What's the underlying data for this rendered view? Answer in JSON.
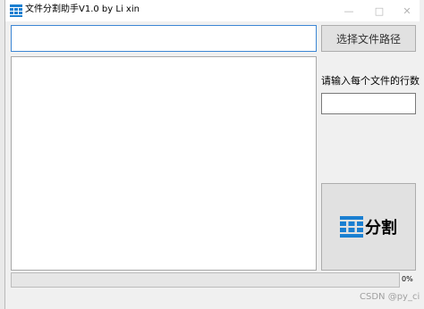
{
  "window": {
    "title": "文件分割助手V1.0 by Li xin",
    "icons": {
      "app": "grid-logo-icon",
      "minimize": "minimize-icon",
      "maximize": "maximize-icon",
      "close": "close-icon"
    },
    "controls": {
      "minimize": "—",
      "maximize": "□",
      "close": "✕"
    }
  },
  "form": {
    "path_value": "",
    "content_value": "",
    "choose_path_label": "选择文件路径",
    "lines_prompt": "请输入每个文件的行数",
    "lines_value": "",
    "split_label": "分割"
  },
  "progress": {
    "value": 0,
    "text": "0%"
  },
  "watermark": "CSDN @py_ci",
  "colors": {
    "accent": "#3c86d4",
    "logo": "#1a7fd1"
  }
}
